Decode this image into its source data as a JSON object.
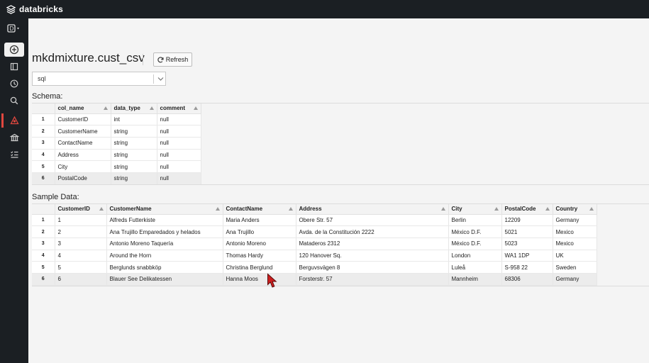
{
  "brand": {
    "name": "databricks"
  },
  "sidebar": {
    "items": [
      {
        "name": "workspace-menu-icon"
      },
      {
        "name": "create-icon"
      },
      {
        "name": "workspace-icon"
      },
      {
        "name": "recents-icon"
      },
      {
        "name": "search-icon"
      },
      {
        "name": "data-icon"
      },
      {
        "name": "clusters-icon"
      },
      {
        "name": "jobs-icon"
      }
    ]
  },
  "page": {
    "title": "mkdmixture.cust_csv",
    "refresh_label": "Refresh",
    "language_value": "sql"
  },
  "schema": {
    "heading": "Schema:",
    "columns": [
      "col_name",
      "data_type",
      "comment"
    ],
    "rows": [
      [
        "1",
        "CustomerID",
        "int",
        "null"
      ],
      [
        "2",
        "CustomerName",
        "string",
        "null"
      ],
      [
        "3",
        "ContactName",
        "string",
        "null"
      ],
      [
        "4",
        "Address",
        "string",
        "null"
      ],
      [
        "5",
        "City",
        "string",
        "null"
      ],
      [
        "6",
        "PostalCode",
        "string",
        "null"
      ]
    ]
  },
  "sample": {
    "heading": "Sample Data:",
    "columns": [
      "CustomerID",
      "CustomerName",
      "ContactName",
      "Address",
      "City",
      "PostalCode",
      "Country"
    ],
    "rows": [
      [
        "1",
        "1",
        "Alfreds Futterkiste",
        "Maria Anders",
        "Obere Str. 57",
        "Berlin",
        "12209",
        "Germany"
      ],
      [
        "2",
        "2",
        "Ana Trujillo Emparedados y helados",
        "Ana Trujillo",
        "Avda. de la Constitución 2222",
        "México D.F.",
        "5021",
        "Mexico"
      ],
      [
        "3",
        "3",
        "Antonio Moreno Taquería",
        "Antonio Moreno",
        "Mataderos 2312",
        "México D.F.",
        "5023",
        "Mexico"
      ],
      [
        "4",
        "4",
        "Around the Horn",
        "Thomas Hardy",
        "120 Hanover Sq.",
        "London",
        "WA1 1DP",
        "UK"
      ],
      [
        "5",
        "5",
        "Berglunds snabbköp",
        "Christina Berglund",
        "Berguvsvägen 8",
        "Luleå",
        "S-958 22",
        "Sweden"
      ],
      [
        "6",
        "6",
        "Blauer See Delikatessen",
        "Hanna Moos",
        "Forsterstr. 57",
        "Mannheim",
        "68306",
        "Germany"
      ]
    ]
  },
  "colors": {
    "sidebar_bg": "#1b1f23",
    "accent": "#e0473f",
    "cursor": "#cc1f1f"
  }
}
